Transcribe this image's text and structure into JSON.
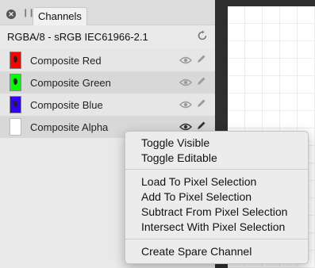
{
  "panel": {
    "tab_label": "Channels",
    "color_profile": "RGBA/8 - sRGB IEC61966-2.1"
  },
  "channels": [
    {
      "label": "Composite Red",
      "color": "#ff0000"
    },
    {
      "label": "Composite Green",
      "color": "#00ff00"
    },
    {
      "label": "Composite Blue",
      "color": "#3300ff"
    },
    {
      "label": "Composite Alpha",
      "color": "#ffffff"
    }
  ],
  "context_menu": {
    "items": [
      "Toggle Visible",
      "Toggle Editable",
      "Load To Pixel Selection",
      "Add To Pixel Selection",
      "Subtract From Pixel Selection",
      "Intersect With Pixel Selection",
      "Create Spare Channel"
    ]
  },
  "icons": {
    "close": "close-icon",
    "pause": "pause-icon",
    "refresh": "refresh-icon",
    "eye": "eye-icon",
    "pencil": "pencil-icon"
  }
}
